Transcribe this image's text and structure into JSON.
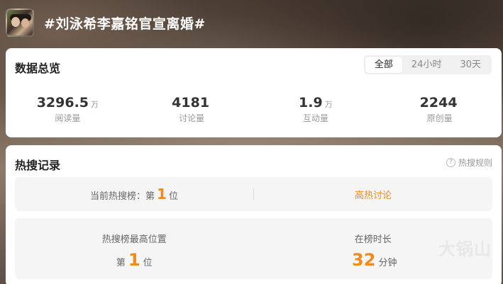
{
  "topic": {
    "title": "#刘泳希李嘉铭官宣离婚#"
  },
  "overview": {
    "title": "数据总览",
    "tabs": [
      "全部",
      "24小时",
      "30天"
    ],
    "stats": [
      {
        "value": "3296.5",
        "unit": "万",
        "label": "阅读量"
      },
      {
        "value": "4181",
        "unit": "",
        "label": "讨论量"
      },
      {
        "value": "1.9",
        "unit": "万",
        "label": "互动量"
      },
      {
        "value": "2244",
        "unit": "",
        "label": "原创量"
      }
    ]
  },
  "hotsearch": {
    "title": "热搜记录",
    "rule_label": "热搜规则",
    "current_label": "当前热搜榜：第",
    "current_rank": "1",
    "rank_suffix": "位",
    "hot_tag": "高热讨论",
    "peak_label": "热搜榜最高位置",
    "peak_prefix": "第",
    "peak_rank": "1",
    "peak_suffix": "位",
    "duration_label": "在榜时长",
    "duration_value": "32",
    "duration_unit": "分钟"
  },
  "watermark": "大锅山",
  "colors": {
    "accent": "#f08a1c"
  },
  "icons": {
    "rule": "question-circle-icon"
  }
}
